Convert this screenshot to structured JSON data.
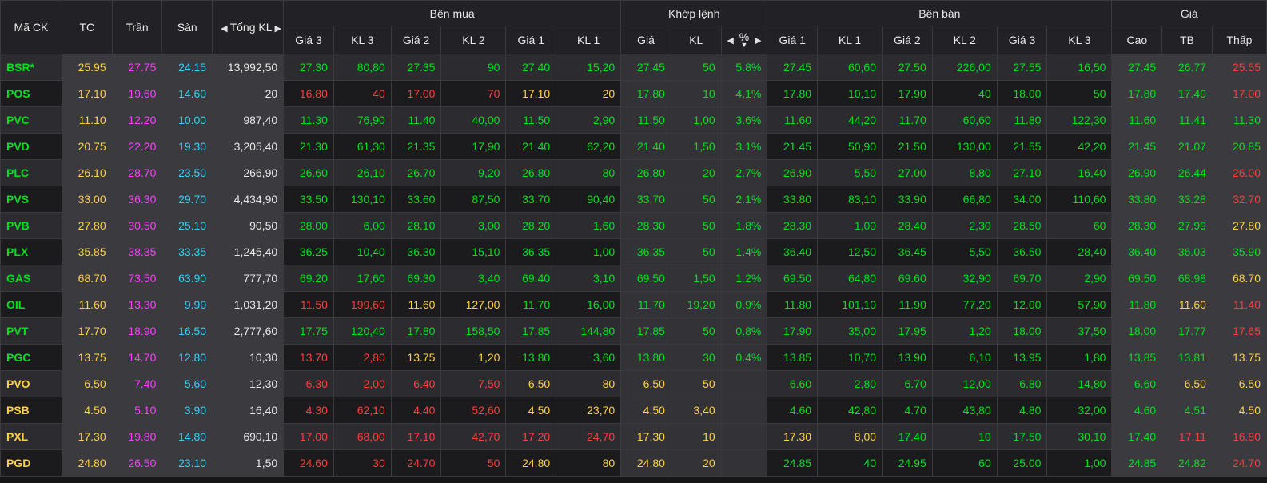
{
  "colors": {
    "up": "#00e11c",
    "down": "#ff3c3c",
    "reference": "#ffd040",
    "ceiling": "#ff3cff",
    "floor": "#34d1f0",
    "neutral": "#e6e6e6"
  },
  "header": {
    "symbol": "Mã CK",
    "ref": "TC",
    "ceil": "Trần",
    "floor": "Sàn",
    "total_vol": "Tổng KL",
    "buy_group": "Bên mua",
    "match_group": "Khớp lệnh",
    "sell_group": "Bên bán",
    "price_group": "Giá",
    "price3": "Giá 3",
    "vol3": "KL 3",
    "price2": "Giá 2",
    "vol2": "KL 2",
    "price1": "Giá 1",
    "vol1": "KL 1",
    "match_price": "Giá",
    "match_vol": "KL",
    "pct": "%",
    "high": "Cao",
    "avg": "TB",
    "low": "Thấp"
  },
  "rows": [
    {
      "sym": "BSR*",
      "tc": "25.95",
      "tran": "27.75",
      "san": "24.15",
      "tkl": "13,992,50",
      "b3": "27.30",
      "bk3": "80,80",
      "b2": "27.35",
      "bk2": "90",
      "b1": "27.40",
      "bk1": "15,20",
      "mp": "27.45",
      "mk": "50",
      "pct": "5.8%",
      "s1": "27.45",
      "sk1": "60,60",
      "s2": "27.50",
      "sk2": "226,00",
      "s3": "27.55",
      "sk3": "16,50",
      "cao": "27.45",
      "tb": "26.77",
      "thap": "25.55"
    },
    {
      "sym": "POS",
      "tc": "17.10",
      "tran": "19.60",
      "san": "14.60",
      "tkl": "20",
      "b3": "16.80",
      "bk3": "40",
      "b2": "17.00",
      "bk2": "70",
      "b1": "17.10",
      "bk1": "20",
      "mp": "17.80",
      "mk": "10",
      "pct": "4.1%",
      "s1": "17.80",
      "sk1": "10,10",
      "s2": "17.90",
      "sk2": "40",
      "s3": "18.00",
      "sk3": "50",
      "cao": "17.80",
      "tb": "17.40",
      "thap": "17.00"
    },
    {
      "sym": "PVC",
      "tc": "11.10",
      "tran": "12.20",
      "san": "10.00",
      "tkl": "987,40",
      "b3": "11.30",
      "bk3": "76,90",
      "b2": "11.40",
      "bk2": "40,00",
      "b1": "11.50",
      "bk1": "2,90",
      "mp": "11.50",
      "mk": "1,00",
      "pct": "3.6%",
      "s1": "11.60",
      "sk1": "44,20",
      "s2": "11.70",
      "sk2": "60,60",
      "s3": "11.80",
      "sk3": "122,30",
      "cao": "11.60",
      "tb": "11.41",
      "thap": "11.30"
    },
    {
      "sym": "PVD",
      "tc": "20.75",
      "tran": "22.20",
      "san": "19.30",
      "tkl": "3,205,40",
      "b3": "21.30",
      "bk3": "61,30",
      "b2": "21.35",
      "bk2": "17,90",
      "b1": "21.40",
      "bk1": "62,20",
      "mp": "21.40",
      "mk": "1,50",
      "pct": "3.1%",
      "s1": "21.45",
      "sk1": "50,90",
      "s2": "21.50",
      "sk2": "130,00",
      "s3": "21.55",
      "sk3": "42,20",
      "cao": "21.45",
      "tb": "21.07",
      "thap": "20.85"
    },
    {
      "sym": "PLC",
      "tc": "26.10",
      "tran": "28.70",
      "san": "23.50",
      "tkl": "266,90",
      "b3": "26.60",
      "bk3": "26,10",
      "b2": "26.70",
      "bk2": "9,20",
      "b1": "26.80",
      "bk1": "80",
      "mp": "26.80",
      "mk": "20",
      "pct": "2.7%",
      "s1": "26.90",
      "sk1": "5,50",
      "s2": "27.00",
      "sk2": "8,80",
      "s3": "27.10",
      "sk3": "16,40",
      "cao": "26.90",
      "tb": "26.44",
      "thap": "26.00"
    },
    {
      "sym": "PVS",
      "tc": "33.00",
      "tran": "36.30",
      "san": "29.70",
      "tkl": "4,434,90",
      "b3": "33.50",
      "bk3": "130,10",
      "b2": "33.60",
      "bk2": "87,50",
      "b1": "33.70",
      "bk1": "90,40",
      "mp": "33.70",
      "mk": "50",
      "pct": "2.1%",
      "s1": "33.80",
      "sk1": "83,10",
      "s2": "33.90",
      "sk2": "66,80",
      "s3": "34.00",
      "sk3": "110,60",
      "cao": "33.80",
      "tb": "33.28",
      "thap": "32.70"
    },
    {
      "sym": "PVB",
      "tc": "27.80",
      "tran": "30.50",
      "san": "25.10",
      "tkl": "90,50",
      "b3": "28.00",
      "bk3": "6,00",
      "b2": "28.10",
      "bk2": "3,00",
      "b1": "28.20",
      "bk1": "1,60",
      "mp": "28.30",
      "mk": "50",
      "pct": "1.8%",
      "s1": "28.30",
      "sk1": "1,00",
      "s2": "28.40",
      "sk2": "2,30",
      "s3": "28.50",
      "sk3": "60",
      "cao": "28.30",
      "tb": "27.99",
      "thap": "27.80"
    },
    {
      "sym": "PLX",
      "tc": "35.85",
      "tran": "38.35",
      "san": "33.35",
      "tkl": "1,245,40",
      "b3": "36.25",
      "bk3": "10,40",
      "b2": "36.30",
      "bk2": "15,10",
      "b1": "36.35",
      "bk1": "1,00",
      "mp": "36.35",
      "mk": "50",
      "pct": "1.4%",
      "s1": "36.40",
      "sk1": "12,50",
      "s2": "36.45",
      "sk2": "5,50",
      "s3": "36.50",
      "sk3": "28,40",
      "cao": "36.40",
      "tb": "36.03",
      "thap": "35.90"
    },
    {
      "sym": "GAS",
      "tc": "68.70",
      "tran": "73.50",
      "san": "63.90",
      "tkl": "777,70",
      "b3": "69.20",
      "bk3": "17,60",
      "b2": "69.30",
      "bk2": "3,40",
      "b1": "69.40",
      "bk1": "3,10",
      "mp": "69.50",
      "mk": "1,50",
      "pct": "1.2%",
      "s1": "69.50",
      "sk1": "64,80",
      "s2": "69.60",
      "sk2": "32,90",
      "s3": "69.70",
      "sk3": "2,90",
      "cao": "69.50",
      "tb": "68.98",
      "thap": "68.70"
    },
    {
      "sym": "OIL",
      "tc": "11.60",
      "tran": "13.30",
      "san": "9.90",
      "tkl": "1,031,20",
      "b3": "11.50",
      "bk3": "199,60",
      "b2": "11.60",
      "bk2": "127,00",
      "b1": "11.70",
      "bk1": "16,00",
      "mp": "11.70",
      "mk": "19,20",
      "pct": "0.9%",
      "s1": "11.80",
      "sk1": "101,10",
      "s2": "11.90",
      "sk2": "77,20",
      "s3": "12.00",
      "sk3": "57,90",
      "cao": "11.80",
      "tb": "11.60",
      "thap": "11.40"
    },
    {
      "sym": "PVT",
      "tc": "17.70",
      "tran": "18.90",
      "san": "16.50",
      "tkl": "2,777,60",
      "b3": "17.75",
      "bk3": "120,40",
      "b2": "17.80",
      "bk2": "158,50",
      "b1": "17.85",
      "bk1": "144,80",
      "mp": "17.85",
      "mk": "50",
      "pct": "0.8%",
      "s1": "17.90",
      "sk1": "35,00",
      "s2": "17.95",
      "sk2": "1,20",
      "s3": "18.00",
      "sk3": "37,50",
      "cao": "18.00",
      "tb": "17.77",
      "thap": "17.65"
    },
    {
      "sym": "PGC",
      "tc": "13.75",
      "tran": "14.70",
      "san": "12.80",
      "tkl": "10,30",
      "b3": "13.70",
      "bk3": "2,80",
      "b2": "13.75",
      "bk2": "1,20",
      "b1": "13.80",
      "bk1": "3,60",
      "mp": "13.80",
      "mk": "30",
      "pct": "0.4%",
      "s1": "13.85",
      "sk1": "10,70",
      "s2": "13.90",
      "sk2": "6,10",
      "s3": "13.95",
      "sk3": "1,80",
      "cao": "13.85",
      "tb": "13.81",
      "thap": "13.75"
    },
    {
      "sym": "PVO",
      "tc": "6.50",
      "tran": "7.40",
      "san": "5.60",
      "tkl": "12,30",
      "b3": "6.30",
      "bk3": "2,00",
      "b2": "6.40",
      "bk2": "7,50",
      "b1": "6.50",
      "bk1": "80",
      "mp": "6.50",
      "mk": "50",
      "pct": "",
      "s1": "6.60",
      "sk1": "2,80",
      "s2": "6.70",
      "sk2": "12,00",
      "s3": "6.80",
      "sk3": "14,80",
      "cao": "6.60",
      "tb": "6.50",
      "thap": "6.50"
    },
    {
      "sym": "PSB",
      "tc": "4.50",
      "tran": "5.10",
      "san": "3.90",
      "tkl": "16,40",
      "b3": "4.30",
      "bk3": "62,10",
      "b2": "4.40",
      "bk2": "52,60",
      "b1": "4.50",
      "bk1": "23,70",
      "mp": "4.50",
      "mk": "3,40",
      "pct": "",
      "s1": "4.60",
      "sk1": "42,80",
      "s2": "4.70",
      "sk2": "43,80",
      "s3": "4.80",
      "sk3": "32,00",
      "cao": "4.60",
      "tb": "4.51",
      "thap": "4.50"
    },
    {
      "sym": "PXL",
      "tc": "17.30",
      "tran": "19.80",
      "san": "14.80",
      "tkl": "690,10",
      "b3": "17.00",
      "bk3": "68,00",
      "b2": "17.10",
      "bk2": "42,70",
      "b1": "17.20",
      "bk1": "24,70",
      "mp": "17.30",
      "mk": "10",
      "pct": "",
      "s1": "17.30",
      "sk1": "8,00",
      "s2": "17.40",
      "sk2": "10",
      "s3": "17.50",
      "sk3": "30,10",
      "cao": "17.40",
      "tb": "17.11",
      "thap": "16.80"
    },
    {
      "sym": "PGD",
      "tc": "24.80",
      "tran": "26.50",
      "san": "23.10",
      "tkl": "1,50",
      "b3": "24.60",
      "bk3": "30",
      "b2": "24.70",
      "bk2": "50",
      "b1": "24.80",
      "bk1": "80",
      "mp": "24.80",
      "mk": "20",
      "pct": "",
      "s1": "24.85",
      "sk1": "40",
      "s2": "24.95",
      "sk2": "60",
      "s3": "25.00",
      "sk3": "1,00",
      "cao": "24.85",
      "tb": "24.82",
      "thap": "24.70"
    }
  ]
}
